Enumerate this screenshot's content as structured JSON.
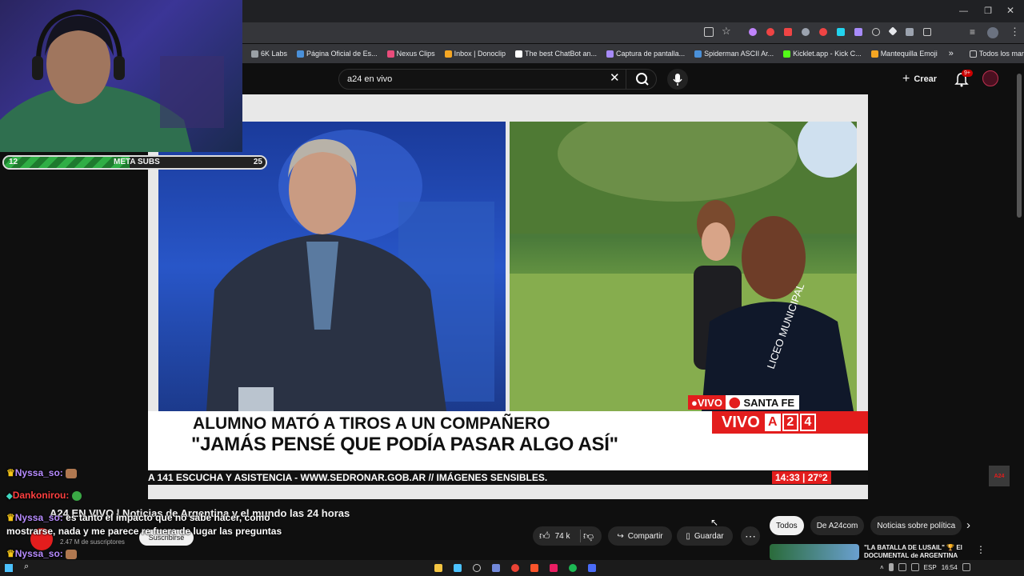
{
  "browser": {
    "bookmarks": [
      {
        "label": "6K Labs",
        "color": "#9aa0a6"
      },
      {
        "label": "Página Oficial de Es...",
        "color": "#4a90d9"
      },
      {
        "label": "Nexus Clips",
        "color": "#e94c7b"
      },
      {
        "label": "Inbox | Donoclip",
        "color": "#f5a623"
      },
      {
        "label": "The best ChatBot an...",
        "color": "#ffffff"
      },
      {
        "label": "Captura de pantalla...",
        "color": "#a78bfa"
      },
      {
        "label": "Spiderman ASCII Ar...",
        "color": "#4a90d9"
      },
      {
        "label": "Kicklet.app - Kick C...",
        "color": "#53fc18"
      },
      {
        "label": "Mantequilla Emoji",
        "color": "#f5a623"
      }
    ],
    "all_bookmarks": "Todos los marcadores",
    "more": "»"
  },
  "youtube": {
    "search_value": "a24 en vivo",
    "create_label": "Crear",
    "notif_badge": "9+",
    "channel_name": "A24 EN VIVO | Noticias de Argentina y el mundo las 24 horas",
    "subscribers": "2.47 M de suscriptores",
    "subscribe_label": "Suscribirse",
    "likes": "74 k",
    "share_label": "Compartir",
    "save_label": "Guardar",
    "chips": [
      "Todos",
      "De A24com",
      "Noticias sobre política"
    ],
    "rec_title": "\"LA BATALLA DE LUSAIL\" 🏆 El DOCUMENTAL de ARGENTINA",
    "watermark": "A24"
  },
  "broadcast": {
    "live_tag": "VIVO",
    "location": "SANTA FE",
    "headline": "ALUMNO MATÓ A TIROS A UN COMPAÑERO",
    "quote": "\"JAMÁS PENSÉ QUE PODÍA PASAR ALGO ASÍ\"",
    "brand_vivo": "VIVO",
    "brand_a24": [
      "A",
      "2",
      "4"
    ],
    "ticker": "A 141 ESCUCHA Y ASISTENCIA - WWW.SEDRONAR.GOB.AR // IMÁGENES SENSIBLES.",
    "time_temp": "14:33 | 27°2",
    "shirt_text": "LICEO MUNICIPAL"
  },
  "overlay": {
    "meta_label": "META SUBS",
    "meta_current": "12",
    "meta_goal": "25",
    "meta_fraction": 0.48,
    "chat": [
      {
        "user": "Nyssa_so:",
        "color": "#b78cff",
        "text": "",
        "badge": "crown"
      },
      {
        "user": "Dankonirou:",
        "color": "#ff4040",
        "text": "",
        "badge": "88"
      },
      {
        "user": "Nyssa_so:",
        "color": "#b78cff",
        "text": "es tanto el impacto que no sabe hacer, como mostrarse, nada y me parece re fuera de lugar las preguntas",
        "badge": "crown"
      },
      {
        "user": "Nyssa_so:",
        "color": "#b78cff",
        "text": "",
        "badge": "crown"
      }
    ]
  },
  "taskbar": {
    "lang": "ESP",
    "time": "16:54"
  }
}
